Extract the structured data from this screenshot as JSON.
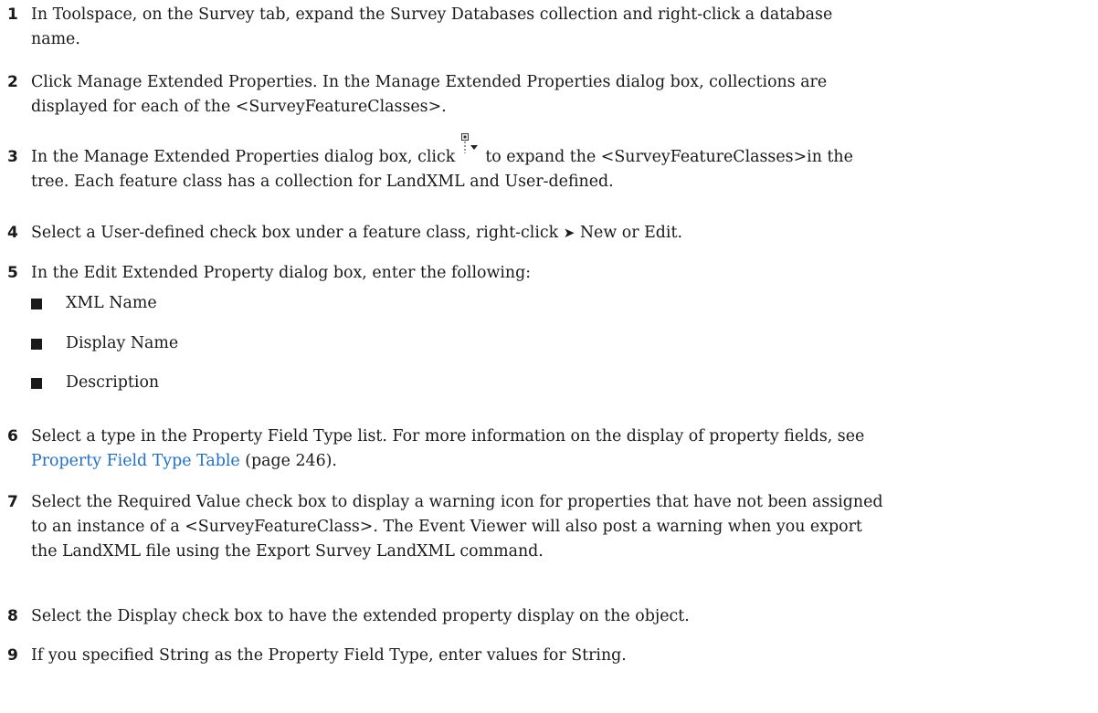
{
  "steps": [
    {
      "num": "1",
      "text": "In Toolspace, on the Survey tab, expand the Survey Databases collection and right-click a database",
      "text2": "name."
    },
    {
      "num": "2",
      "text": "Click Manage Extended Properties. In the Manage Extended Properties dialog box, collections are",
      "text2": "displayed for each of the <SurveyFeatureClasses>."
    },
    {
      "num": "3",
      "text_a": "In the Manage Extended Properties dialog box, click",
      "text_b": "to expand the <SurveyFeatureClasses>in the",
      "text2": "tree. Each feature class has a collection for LandXML and User-defined."
    },
    {
      "num": "4",
      "text_a": "Select a User-defined check box under a feature class, right-click",
      "arrow": "➤",
      "text_b": "New or Edit."
    },
    {
      "num": "5",
      "text": "In the Edit Extended Property dialog box, enter the following:"
    },
    {
      "num": "6",
      "text": "Select a type in the Property Field Type list. For more information on the display of property fields, see",
      "link": "Property Field Type Table",
      "page_ref": "(page 246)."
    },
    {
      "num": "7",
      "text": "Select the Required Value check box to display a warning icon for properties that have not been assigned",
      "text2": "to an instance of a <SurveyFeatureClass>. The Event Viewer will also post a warning when you export",
      "text3": "the LandXML file using the Export Survey LandXML command."
    },
    {
      "num": "8",
      "text": "Select the Display check box to have the extended property display on the object."
    },
    {
      "num": "9",
      "text": "If you specified String as the Property Field Type, enter values for String."
    }
  ],
  "bullets": [
    "XML Name",
    "Display Name",
    "Description"
  ],
  "icons": {
    "expand": "expand-tree-icon"
  }
}
